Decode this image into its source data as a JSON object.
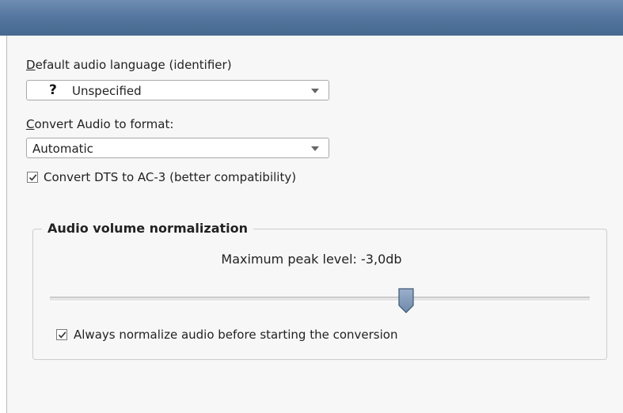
{
  "audio_language": {
    "label": "Default audio language (identifier)",
    "label_mnemonic": "D",
    "label_rest": "efault audio language (identifier)",
    "selected_icon": "question-mark-icon",
    "selected_icon_glyph": "?",
    "selected": "Unspecified"
  },
  "convert_format": {
    "label_mnemonic": "C",
    "label_rest": "onvert Audio to format:",
    "selected": "Automatic"
  },
  "convert_dts": {
    "label": "Convert DTS to AC-3 (better compatibility)",
    "checked": true
  },
  "normalization": {
    "group_title": "Audio volume normalization",
    "peak_label": "Maximum peak level: -3,0db",
    "slider_level_fraction": 0.66,
    "always_normalize_label": "Always normalize audio before starting the conversion",
    "always_normalize_checked": true
  },
  "colors": {
    "titlebar": "#5577a0",
    "panel_background": "#f7f7f7",
    "slider_thumb": "#7f98b8"
  }
}
